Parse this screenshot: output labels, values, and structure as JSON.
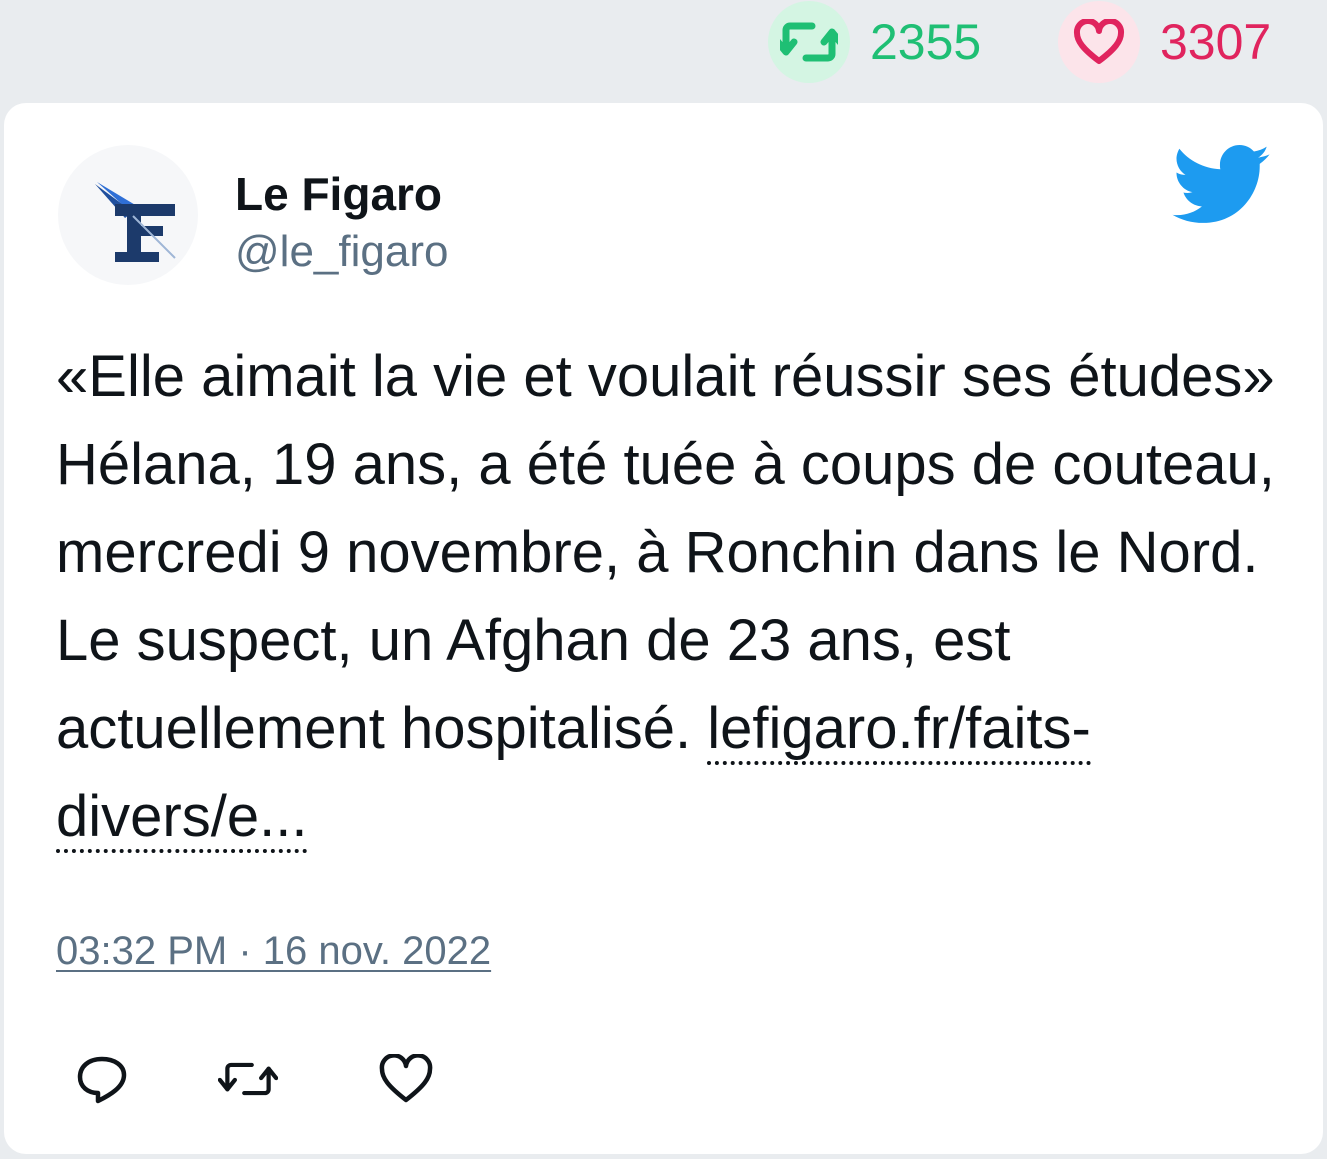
{
  "stats": {
    "retweet_count": "2355",
    "like_count": "3307",
    "retweet_color": "#1fbf74",
    "like_color": "#e0245e"
  },
  "tweet": {
    "author_name": "Le Figaro",
    "author_handle": "@le_figaro",
    "avatar_icon": "le-figaro-logo-icon",
    "platform_icon": "twitter-bird-icon",
    "text": "«Elle aimait la vie et voulait réussir ses études» Hélana, 19 ans, a été tuée à coups de couteau, mercredi 9 novembre, à Ronchin dans le Nord. Le suspect, un Afghan de 23 ans, est actuellement hospitalisé.",
    "link_text": "lefigaro.fr/faits-divers/e...",
    "timestamp": "03:32 PM · 16 nov. 2022"
  },
  "actions": {
    "icons": [
      "reply-icon",
      "retweet-icon",
      "like-icon"
    ]
  }
}
